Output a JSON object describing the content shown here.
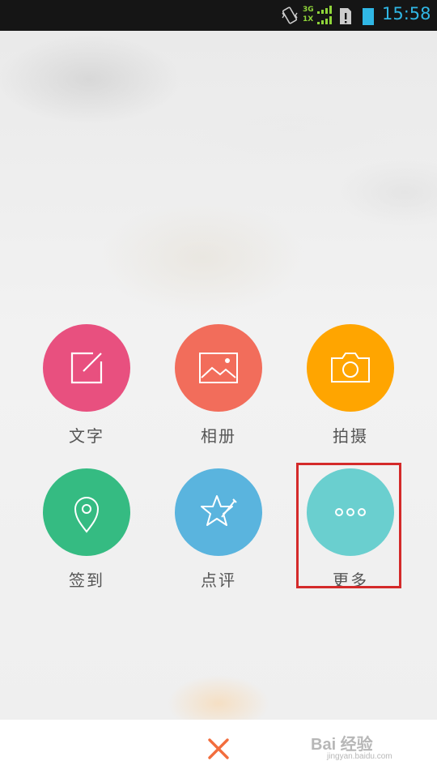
{
  "status_bar": {
    "network_top": "3G",
    "network_bottom": "1X",
    "time": "15:58",
    "time_color": "#30b7e5"
  },
  "actions": [
    {
      "label": "文字",
      "icon": "edit-icon",
      "color": "#e8507f"
    },
    {
      "label": "相册",
      "icon": "image-icon",
      "color": "#f26d5b"
    },
    {
      "label": "拍摄",
      "icon": "camera-icon",
      "color": "#ffa500"
    },
    {
      "label": "签到",
      "icon": "location-pin-icon",
      "color": "#35bb82"
    },
    {
      "label": "点评",
      "icon": "star-pen-icon",
      "color": "#5ab4de"
    },
    {
      "label": "更多",
      "icon": "more-dots-icon",
      "color": "#6acfcf"
    }
  ],
  "highlight_color": "#d42a2a",
  "bottom_bar": {
    "close_icon": "close-icon",
    "close_color": "#f26d3d"
  },
  "watermark": {
    "main": "Bai 经验",
    "sub": "jingyan.baidu.com"
  }
}
